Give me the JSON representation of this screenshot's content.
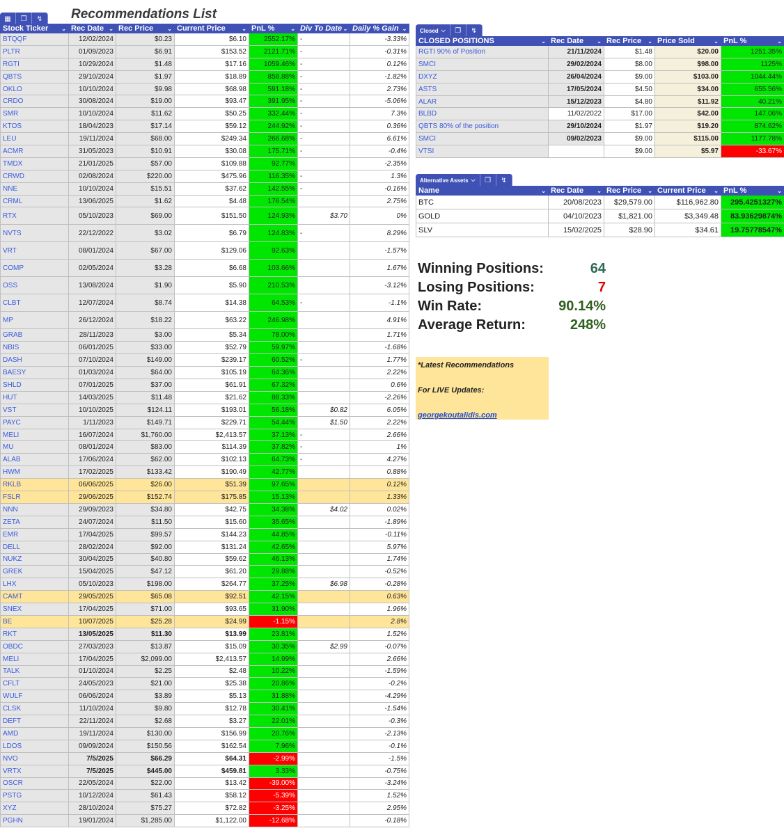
{
  "title": "Recommendations List",
  "colors": {
    "header": "#3f51b5",
    "positive": "#00e600",
    "negative": "#ff0000",
    "highlight": "#ffe599",
    "ticker": "#3b5bdb"
  },
  "main": {
    "headers": [
      "Stock Ticker",
      "Rec Date",
      "Rec Price",
      "Current Price",
      "PnL %",
      "Div To Date",
      "Daily % Gain"
    ],
    "rows": [
      [
        "BTQQF",
        "12/02/2024",
        "$0.23",
        "$6.10",
        "2552.17%",
        "-",
        "-3.33%"
      ],
      [
        "PLTR",
        "01/09/2023",
        "$6.91",
        "$153.52",
        "2121.71%",
        "-",
        "-0.31%"
      ],
      [
        "RGTI",
        "10/29/2024",
        "$1.48",
        "$17.16",
        "1059.46%",
        "-",
        "0.12%"
      ],
      [
        "QBTS",
        "29/10/2024",
        "$1.97",
        "$18.89",
        "858.88%",
        "-",
        "-1.82%"
      ],
      [
        "OKLO",
        "10/10/2024",
        "$9.98",
        "$68.98",
        "591.18%",
        "-",
        "2.73%"
      ],
      [
        "CRDO",
        "30/08/2024",
        "$19.00",
        "$93.47",
        "391.95%",
        "-",
        "-5.06%"
      ],
      [
        "SMR",
        "10/10/2024",
        "$11.62",
        "$50.25",
        "332.44%",
        "-",
        "7.3%"
      ],
      [
        "KTOS",
        "18/04/2023",
        "$17.14",
        "$59.12",
        "244.92%",
        "-",
        "0.36%"
      ],
      [
        "LEU",
        "19/11/2024",
        "$68.00",
        "$249.34",
        "266.68%",
        "-",
        "6.61%"
      ],
      [
        "ACMR",
        "31/05/2023",
        "$10.91",
        "$30.08",
        "175.71%",
        "-",
        "-0.4%"
      ],
      [
        "TMDX",
        "21/01/2025",
        "$57.00",
        "$109.88",
        "92.77%",
        "",
        "-2.35%"
      ],
      [
        "CRWD",
        "02/08/2024",
        "$220.00",
        "$475.96",
        "116.35%",
        "-",
        "1.3%"
      ],
      [
        "NNE",
        "10/10/2024",
        "$15.51",
        "$37.62",
        "142.55%",
        "-",
        "-0.16%"
      ],
      [
        "CRML",
        "13/06/2025",
        "$1.62",
        "$4.48",
        "176.54%",
        "",
        "2.75%"
      ],
      [
        "RTX",
        "05/10/2023",
        "$69.00",
        "$151.50",
        "124.93%",
        "$3.70",
        "0%"
      ],
      [
        "NVTS",
        "22/12/2022",
        "$3.02",
        "$6.79",
        "124.83%",
        "-",
        "8.29%"
      ],
      [
        "VRT",
        "08/01/2024",
        "$67.00",
        "$129.06",
        "92.63%",
        "",
        "-1.57%"
      ],
      [
        "COMP",
        "02/05/2024",
        "$3.28",
        "$6.68",
        "103.66%",
        "",
        "1.67%"
      ],
      [
        "OSS",
        "13/08/2024",
        "$1.90",
        "$5.90",
        "210.53%",
        "",
        "-3.12%"
      ],
      [
        "CLBT",
        "12/07/2024",
        "$8.74",
        "$14.38",
        "64.53%",
        "-",
        "-1.1%"
      ],
      [
        "MP",
        "26/12/2024",
        "$18.22",
        "$63.22",
        "246.98%",
        "",
        "4.91%"
      ],
      [
        "GRAB",
        "28/11/2023",
        "$3.00",
        "$5.34",
        "78.00%",
        "",
        "1.71%"
      ],
      [
        "NBIS",
        "06/01/2025",
        "$33.00",
        "$52.79",
        "59.97%",
        "",
        "-1.68%"
      ],
      [
        "DASH",
        "07/10/2024",
        "$149.00",
        "$239.17",
        "60.52%",
        "-",
        "1.77%"
      ],
      [
        "BAESY",
        "01/03/2024",
        "$64.00",
        "$105.19",
        "64.36%",
        "",
        "2.22%"
      ],
      [
        "SHLD",
        "07/01/2025",
        "$37.00",
        "$61.91",
        "67.32%",
        "",
        "0.6%"
      ],
      [
        "HUT",
        "14/03/2025",
        "$11.48",
        "$21.62",
        "88.33%",
        "",
        "-2.26%"
      ],
      [
        "VST",
        "10/10/2025",
        "$124.11",
        "$193.01",
        "56.18%",
        "$0.82",
        "6.05%"
      ],
      [
        "PAYC",
        "1/11/2023",
        "$149.71",
        "$229.71",
        "54.44%",
        "$1.50",
        "2.22%"
      ],
      [
        "MELI",
        "16/07/2024",
        "$1,760.00",
        "$2,413.57",
        "37.13%",
        "-",
        "2.66%"
      ],
      [
        "MU",
        "08/01/2024",
        "$83.00",
        "$114.39",
        "37.82%",
        "-",
        "1%"
      ],
      [
        "ALAB",
        "17/06/2024",
        "$62.00",
        "$102.13",
        "64.73%",
        "-",
        "4.27%"
      ],
      [
        "HWM",
        "17/02/2025",
        "$133.42",
        "$190.49",
        "42.77%",
        "",
        "0.88%"
      ],
      [
        "RKLB",
        "06/06/2025",
        "$26.00",
        "$51.39",
        "97.65%",
        "",
        "0.12%"
      ],
      [
        "FSLR",
        "29/06/2025",
        "$152.74",
        "$175.85",
        "15.13%",
        "",
        "1.33%"
      ],
      [
        "NNN",
        "29/09/2023",
        "$34.80",
        "$42.75",
        "34.38%",
        "$4.02",
        "0.02%"
      ],
      [
        "ZETA",
        "24/07/2024",
        "$11.50",
        "$15.60",
        "35.65%",
        "",
        "-1.89%"
      ],
      [
        "EMR",
        "17/04/2025",
        "$99.57",
        "$144.23",
        "44.85%",
        "",
        "-0.11%"
      ],
      [
        "DELL",
        "28/02/2024",
        "$92.00",
        "$131.24",
        "42.65%",
        "",
        "5.97%"
      ],
      [
        "NUKZ",
        "30/04/2025",
        "$40.80",
        "$59.62",
        "46.13%",
        "",
        "1.74%"
      ],
      [
        "GREK",
        "15/04/2025",
        "$47.12",
        "$61.20",
        "29.88%",
        "",
        "-0.52%"
      ],
      [
        "LHX",
        "05/10/2023",
        "$198.00",
        "$264.77",
        "37.25%",
        "$6.98",
        "-0.28%"
      ],
      [
        "CAMT",
        "29/05/2025",
        "$65.08",
        "$92.51",
        "42.15%",
        "",
        "0.63%"
      ],
      [
        "SNEX",
        "17/04/2025",
        "$71.00",
        "$93.65",
        "31.90%",
        "",
        "1.96%"
      ],
      [
        "BE",
        "10/07/2025",
        "$25.28",
        "$24.99",
        "-1.15%",
        "",
        "2.8%"
      ],
      [
        "RKT",
        "13/05/2025",
        "$11.30",
        "$13.99",
        "23.81%",
        "",
        "1.52%"
      ],
      [
        "OBDC",
        "27/03/2023",
        "$13.87",
        "$15.09",
        "30.35%",
        "$2.99",
        "-0.07%"
      ],
      [
        "MELI",
        "17/04/2025",
        "$2,099.00",
        "$2,413.57",
        "14.99%",
        "",
        "2.66%"
      ],
      [
        "TALK",
        "01/10/2024",
        "$2.25",
        "$2.48",
        "10.22%",
        "",
        "-1.59%"
      ],
      [
        "CFLT",
        "24/05/2023",
        "$21.00",
        "$25.38",
        "20.86%",
        "",
        "-0.2%"
      ],
      [
        "WULF",
        "06/06/2024",
        "$3.89",
        "$5.13",
        "31.88%",
        "",
        "-4.29%"
      ],
      [
        "CLSK",
        "11/10/2024",
        "$9.80",
        "$12.78",
        "30.41%",
        "",
        "-1.54%"
      ],
      [
        "DEFT",
        "22/11/2024",
        "$2.68",
        "$3.27",
        "22.01%",
        "",
        "-0.3%"
      ],
      [
        "AMD",
        "19/11/2024",
        "$130.00",
        "$156.99",
        "20.76%",
        "",
        "-2.13%"
      ],
      [
        "LDOS",
        "09/09/2024",
        "$150.56",
        "$162.54",
        "7.96%",
        "",
        "-0.1%"
      ],
      [
        "NVO",
        "7/5/2025",
        "$66.29",
        "$64.31",
        "-2.99%",
        "",
        "-1.5%"
      ],
      [
        "VRTX",
        "7/5/2025",
        "$445.00",
        "$459.81",
        "3.33%",
        "",
        "-0.75%"
      ],
      [
        "OSCR",
        "22/05/2024",
        "$22.00",
        "$13.42",
        "-39.00%",
        "",
        "-3.24%"
      ],
      [
        "PSTG",
        "10/12/2024",
        "$61.43",
        "$58.12",
        "-5.39%",
        "",
        "1.52%"
      ],
      [
        "XYZ",
        "28/10/2024",
        "$75.27",
        "$72.82",
        "-3.25%",
        "",
        "2.95%"
      ],
      [
        "PGHN",
        "19/01/2024",
        "$1,285.00",
        "$1,122.00",
        "-12.68%",
        "",
        "-0.18%"
      ]
    ]
  },
  "closed": {
    "toolbar_label": "Closed",
    "headers": [
      "CLOSED POSITIONS",
      "Rec Date",
      "Rec Price",
      "Price Sold",
      "PnL %"
    ],
    "rows": [
      [
        "RGTI 90% of Position",
        "21/11/2024",
        "$1.48",
        "$20.00",
        "1251.35%"
      ],
      [
        "SMCI",
        "29/02/2024",
        "$8.00",
        "$98.00",
        "1125%"
      ],
      [
        "DXYZ",
        "26/04/2024",
        "$9.00",
        "$103.00",
        "1044.44%"
      ],
      [
        "ASTS",
        "17/05/2024",
        "$4.50",
        "$34.00",
        "655.56%"
      ],
      [
        "ALAR",
        "15/12/2023",
        "$4.80",
        "$11.92",
        "40.21%"
      ],
      [
        "BLBD",
        "11/02/2022",
        "$17.00",
        "$42.00",
        "147.06%"
      ],
      [
        "QBTS 80% of the position",
        "29/10/2024",
        "$1.97",
        "$19.20",
        "874.62%"
      ],
      [
        "SMCI",
        "09/02/2023",
        "$9.00",
        "$115.00",
        "1177.78%"
      ],
      [
        "VTSI",
        "",
        "$9.00",
        "$5.97",
        "-33.67%"
      ]
    ]
  },
  "alt": {
    "toolbar_label": "Alternative Assets",
    "headers": [
      "Name",
      "Rec Date",
      "Rec Price",
      "Current Price",
      "PnL %"
    ],
    "rows": [
      [
        "BTC",
        "20/08/2023",
        "$29,579.00",
        "$116,962.80",
        "295.4251327%"
      ],
      [
        "GOLD",
        "04/10/2023",
        "$1,821.00",
        "$3,349.48",
        "83.93629874%"
      ],
      [
        "SLV",
        "15/02/2025",
        "$28.90",
        "$34.61",
        "19.75778547%"
      ]
    ]
  },
  "stats": [
    {
      "label": "Winning Positions:",
      "value": "64",
      "color": "#2e6b55"
    },
    {
      "label": "Losing Positions:",
      "value": "7",
      "color": "#e00000"
    },
    {
      "label": "Win Rate:",
      "value": "90.14%",
      "color": "#2f5f1f"
    },
    {
      "label": "Average Return:",
      "value": "248%",
      "color": "#2f5f1f"
    }
  ],
  "note": {
    "line1": "*Latest Recommendations",
    "line2": "For LIVE Updates:",
    "link": "georgekoutalidis.com"
  }
}
